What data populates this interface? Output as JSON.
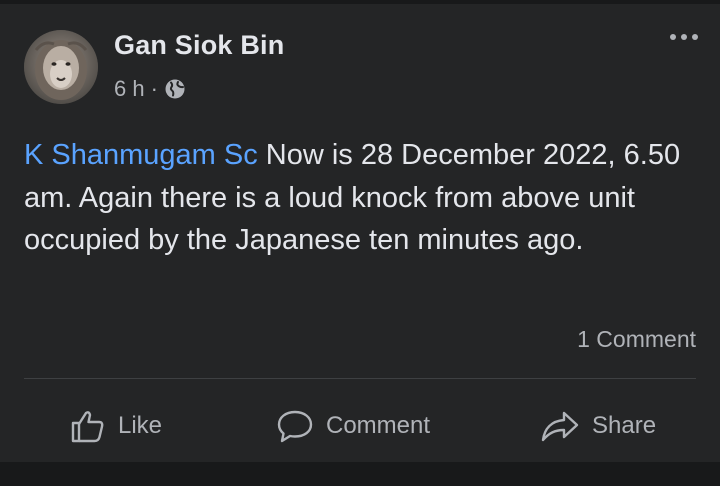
{
  "post": {
    "author": "Gan Siok Bin",
    "time": "6 h",
    "separator": "·",
    "privacy_icon": "globe-icon",
    "mention": "K Shanmugam Sc",
    "body": " Now is 28 December 2022, 6.50 am. Again there is a loud knock from above unit occupied by the Japanese ten minutes ago.",
    "comment_count": "1 Comment"
  },
  "actions": {
    "like": "Like",
    "comment": "Comment",
    "share": "Share"
  },
  "colors": {
    "background": "#18191a",
    "card": "#242526",
    "text_primary": "#e4e6eb",
    "text_secondary": "#b0b3b8",
    "mention": "#5aa3ff",
    "divider": "#3e4042"
  }
}
